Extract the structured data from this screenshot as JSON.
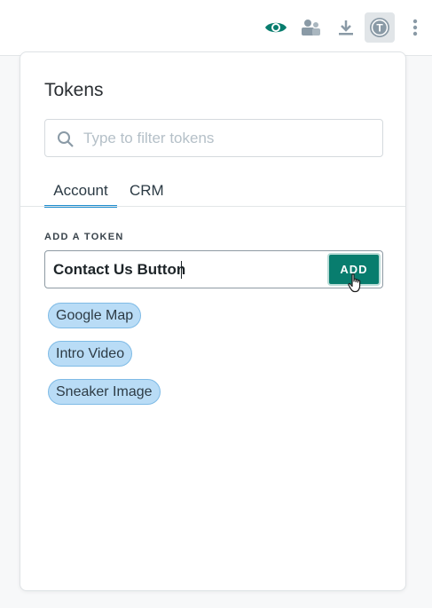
{
  "topbar": {
    "icons": [
      "eye-icon",
      "users-icon",
      "download-icon",
      "token-icon",
      "more-vertical-icon"
    ],
    "token_icon_letter": "T",
    "accent_color": "#087d6e"
  },
  "panel": {
    "title": "Tokens",
    "search": {
      "placeholder": "Type to filter tokens",
      "value": ""
    },
    "tabs": [
      {
        "label": "Account",
        "active": true
      },
      {
        "label": "CRM",
        "active": false
      }
    ],
    "add_section": {
      "label": "ADD A TOKEN",
      "input_value": "Contact Us Button",
      "button_label": "ADD"
    },
    "tokens": [
      {
        "label": "Google Map"
      },
      {
        "label": "Intro Video"
      },
      {
        "label": "Sneaker Image"
      }
    ]
  }
}
